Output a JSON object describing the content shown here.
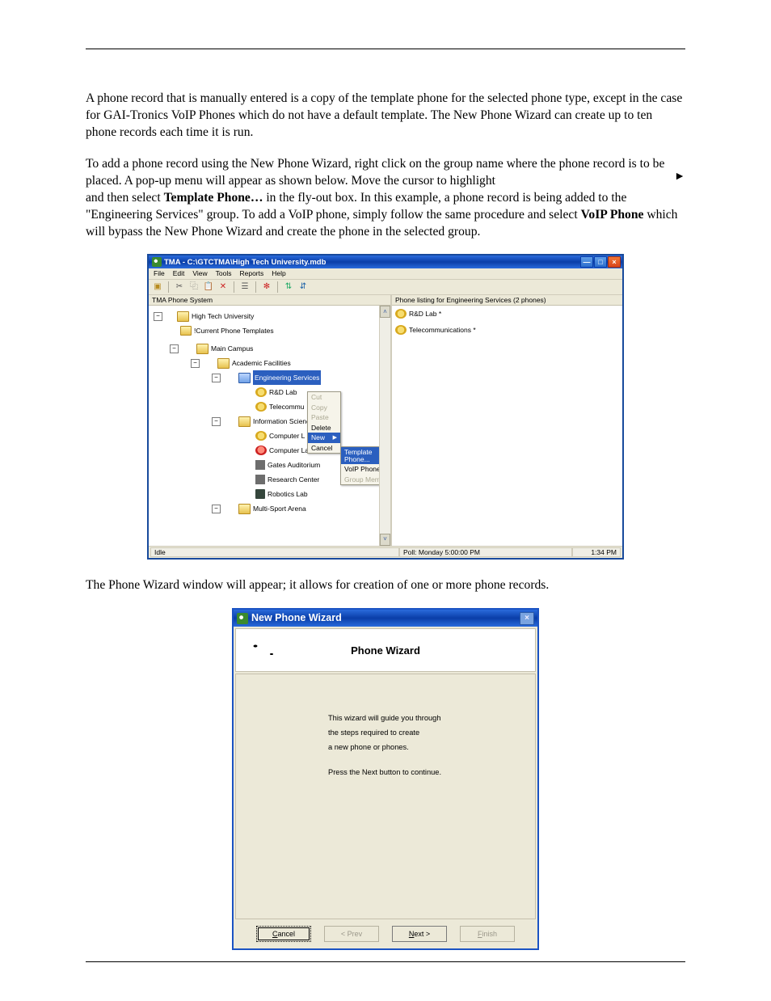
{
  "paragraphs": {
    "p1": "A phone record that is manually entered is a copy of the template phone for the selected phone type, except in the case for GAI-Tronics VoIP Phones which do not have a default template.  The New Phone Wizard can create up to ten phone records each time it is run.",
    "p2a": "To add a phone record using the New Phone Wizard, right click on the group name where the phone record is to be placed.  A pop-up menu will appear as shown below.  Move the cursor to highlight",
    "p2b": "and then select ",
    "p2bold": "Template Phone…",
    "p2c": " in the fly-out box.  In this example, a phone record is being added to the \"Engineering Services\" group.  To add a VoIP phone, simply follow the same procedure and select ",
    "p2bold2": "VoIP Phone",
    "p2d": " which will bypass the New Phone Wizard and create the phone in the selected group.",
    "arrow": "►",
    "p3": "The Phone Wizard window will appear; it allows for creation of one or more phone records."
  },
  "tma": {
    "title": "TMA - C:\\GTCTMA\\High Tech University.mdb",
    "menus": [
      "File",
      "Edit",
      "View",
      "Tools",
      "Reports",
      "Help"
    ],
    "leftHeader": "TMA Phone System",
    "rightHeader": "Phone listing for Engineering Services (2 phones)",
    "tree": {
      "n0": "High Tech University",
      "n1": "!Current Phone Templates",
      "n2": "Main Campus",
      "n3": "Academic Facilities",
      "n4": "Engineering Services",
      "n5": "R&D Lab",
      "n6": "Telecommu",
      "n7": "Information Science",
      "n8": "Computer L",
      "n9": "Computer Lab B",
      "n10": "Gates Auditorium",
      "n11": "Research Center",
      "n12": "Robotics Lab",
      "n13": "Multi-Sport Arena"
    },
    "context": {
      "cut": "Cut",
      "copy": "Copy",
      "paste": "Paste",
      "delete": "Delete",
      "new": "New",
      "cancel": "Cancel"
    },
    "flyout": {
      "template": "Template Phone...",
      "voip": "VoIP Phone...",
      "group": "Group Member"
    },
    "rightList": {
      "r0": "R&D Lab *",
      "r1": "Telecommunications *"
    },
    "status": {
      "idle": "Idle",
      "poll": "Poll:  Monday 5:00:00 PM",
      "time": "1:34 PM"
    }
  },
  "wizard": {
    "title": "New Phone Wizard",
    "heading": "Phone Wizard",
    "line1": "This wizard will guide you through",
    "line2": "the steps required to create",
    "line3": "a new phone or phones.",
    "line4": "Press the Next button to continue.",
    "buttons": {
      "cancel": "Cancel",
      "prev": "< Prev",
      "next": "Next >",
      "finish": "Finish"
    }
  }
}
